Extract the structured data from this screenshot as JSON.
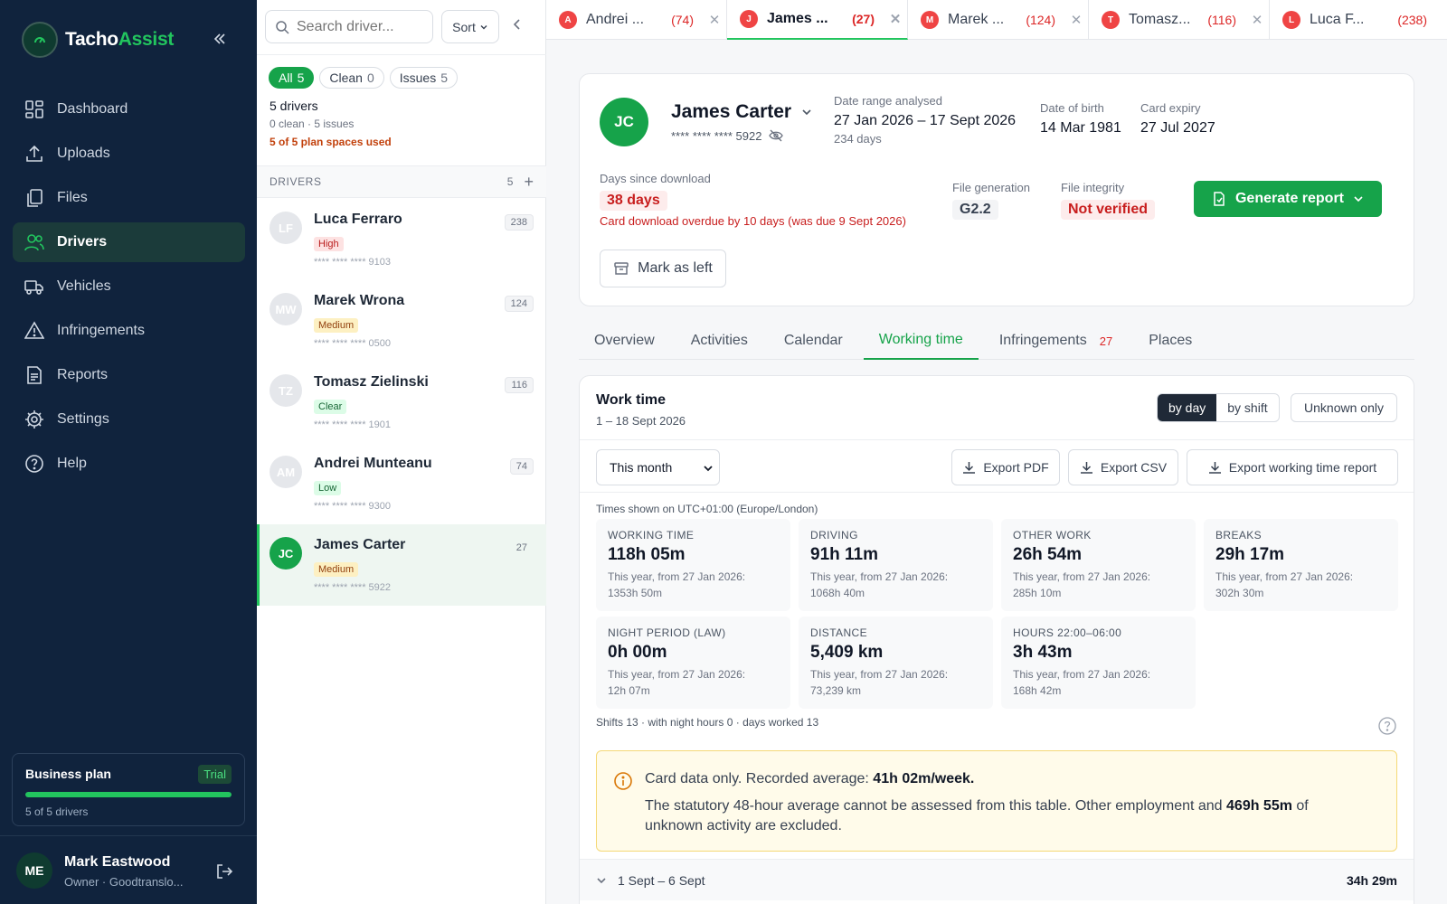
{
  "app": {
    "name_part1": "Tacho",
    "name_part2": "Assist"
  },
  "sidebar": {
    "items": [
      {
        "label": "Dashboard",
        "icon": "grid-icon"
      },
      {
        "label": "Uploads",
        "icon": "upload-icon"
      },
      {
        "label": "Files",
        "icon": "files-icon"
      },
      {
        "label": "Drivers",
        "icon": "users-icon",
        "active": true
      },
      {
        "label": "Vehicles",
        "icon": "truck-icon"
      },
      {
        "label": "Infringements",
        "icon": "warning-icon"
      },
      {
        "label": "Reports",
        "icon": "report-icon"
      },
      {
        "label": "Settings",
        "icon": "gear-icon"
      },
      {
        "label": "Help",
        "icon": "help-icon"
      }
    ],
    "plan": {
      "name": "Business plan",
      "badge": "Trial",
      "usage": "5 of 5 drivers",
      "used_fraction": 1.0
    },
    "user": {
      "initials": "ME",
      "name": "Mark Eastwood",
      "role": "Owner · Goodtranslo..."
    }
  },
  "driver_panel": {
    "search_placeholder": "Search driver...",
    "sort_label": "Sort",
    "filters": [
      {
        "label": "All",
        "count": "5",
        "active": true
      },
      {
        "label": "Clean",
        "count": "0"
      },
      {
        "label": "Issues",
        "count": "5"
      }
    ],
    "summary": {
      "drivers": "5 drivers",
      "detail": "0 clean · 5 issues",
      "plan_spaces": "5 of 5 plan spaces used"
    },
    "list_header": "DRIVERS",
    "list_count": "5",
    "drivers": [
      {
        "initials": "LF",
        "name": "Luca Ferraro",
        "risk": "High",
        "card": "**** **** **** 9103",
        "count": "238"
      },
      {
        "initials": "MW",
        "name": "Marek Wrona",
        "risk": "Medium",
        "card": "**** **** **** 0500",
        "count": "124"
      },
      {
        "initials": "TZ",
        "name": "Tomasz Zielinski",
        "risk": "Clear",
        "card": "**** **** **** 1901",
        "count": "116"
      },
      {
        "initials": "AM",
        "name": "Andrei Munteanu",
        "risk": "Low",
        "card": "**** **** **** 9300",
        "count": "74"
      },
      {
        "initials": "JC",
        "name": "James Carter",
        "risk": "Medium",
        "card": "**** **** **** 5922",
        "count": "27",
        "selected": true
      }
    ]
  },
  "tabs": [
    {
      "initial": "A",
      "label": "Andrei ...",
      "count": "(74)"
    },
    {
      "initial": "J",
      "label": "James ...",
      "count": "(27)",
      "active": true
    },
    {
      "initial": "M",
      "label": "Marek ...",
      "count": "(124)"
    },
    {
      "initial": "T",
      "label": "Tomasz...",
      "count": "(116)"
    },
    {
      "initial": "L",
      "label": "Luca F...",
      "count": "(238)"
    }
  ],
  "driver": {
    "initials": "JC",
    "name": "James Carter",
    "card": "**** **** **** 5922",
    "date_range_label": "Date range analysed",
    "date_range": "27 Jan 2026 – 17 Sept 2026",
    "date_range_days": "234 days",
    "dob_label": "Date of birth",
    "dob": "14 Mar 1981",
    "expiry_label": "Card expiry",
    "expiry": "27 Jul 2027",
    "days_label": "Days since download",
    "days": "38 days",
    "overdue": "Card download overdue by 10 days (was due 9 Sept 2026)",
    "filegen_label": "File generation",
    "filegen": "G2.2",
    "integrity_label": "File integrity",
    "integrity": "Not verified",
    "generate_label": "Generate report",
    "mark_label": "Mark as left"
  },
  "subtabs": [
    {
      "label": "Overview"
    },
    {
      "label": "Activities"
    },
    {
      "label": "Calendar"
    },
    {
      "label": "Working time",
      "active": true
    },
    {
      "label": "Infringements",
      "count": "27"
    },
    {
      "label": "Places"
    }
  ],
  "work": {
    "title": "Work time",
    "range": "1 – 18 Sept 2026",
    "seg_day": "by day",
    "seg_shift": "by shift",
    "unknown_only": "Unknown only",
    "period_select": "This month",
    "export_pdf": "Export PDF",
    "export_csv": "Export CSV",
    "export_report": "Export working time report",
    "timezone": "Times shown on UTC+01:00 (Europe/London)",
    "stats": [
      {
        "label": "WORKING TIME",
        "value": "118h 05m",
        "sub1": "This year, from 27 Jan 2026:",
        "sub2": "1353h 50m"
      },
      {
        "label": "DRIVING",
        "value": "91h 11m",
        "sub1": "This year, from 27 Jan 2026:",
        "sub2": "1068h 40m"
      },
      {
        "label": "OTHER WORK",
        "value": "26h 54m",
        "sub1": "This year, from 27 Jan 2026:",
        "sub2": "285h 10m"
      },
      {
        "label": "BREAKS",
        "value": "29h 17m",
        "sub1": "This year, from 27 Jan 2026:",
        "sub2": "302h 30m"
      },
      {
        "label": "NIGHT PERIOD (LAW)",
        "value": "0h 00m",
        "sub1": "This year, from 27 Jan 2026:",
        "sub2": "12h 07m"
      },
      {
        "label": "DISTANCE",
        "value": "5,409 km",
        "sub1": "This year, from 27 Jan 2026:",
        "sub2": "73,239 km"
      },
      {
        "label": "HOURS 22:00–06:00",
        "value": "3h 43m",
        "sub1": "This year, from 27 Jan 2026:",
        "sub2": "168h 42m"
      }
    ],
    "shifts_line": "Shifts 13 · with night hours 0 · days worked 13",
    "note_line1_pre": "Card data only. Recorded average: ",
    "note_line1_val": "41h 02m/week.",
    "note_line2_pre": "The statutory 48-hour average cannot be assessed from this table. Other employment and ",
    "note_line2_val": "469h 55m",
    "note_line2_post": " of unknown activity are excluded.",
    "week_label": "1 Sept – 6 Sept",
    "week_total": "34h 29m"
  }
}
